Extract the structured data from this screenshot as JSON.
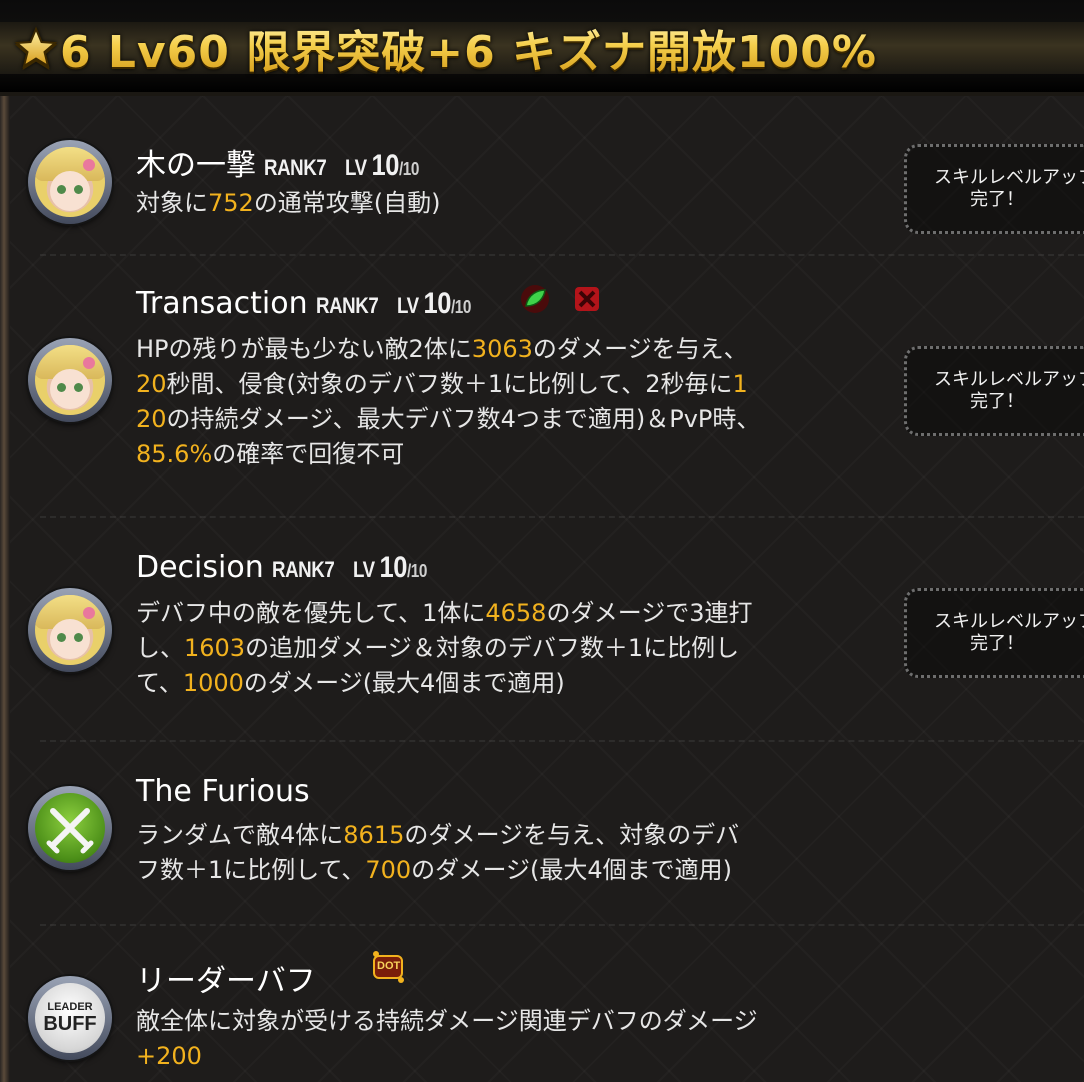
{
  "header": {
    "title": "6 Lv60 限界突破+6 キズナ開放100%"
  },
  "skills": [
    {
      "name": "木の一撃",
      "rank": "RANK7",
      "lv_prefix": "LV",
      "lv": "10",
      "lv_max": "/10",
      "desc": {
        "a": "対象に",
        "n1": "752",
        "b": "の通常攻撃(自動)"
      },
      "button": {
        "line1": "スキルレベルアップ",
        "line2": "完了！"
      }
    },
    {
      "name": "Transaction",
      "rank": "RANK7",
      "lv_prefix": "LV",
      "lv": "10",
      "lv_max": "/10",
      "desc": {
        "l1a": "HPの残りが最も少ない敵2体に",
        "n1": "3063",
        "l1b": "のダメージを与え、",
        "n2": "20",
        "l2a": "秒間、侵食(対象のデバフ数＋1に比例して、2秒毎に",
        "n3a": "1",
        "n3b": "20",
        "l3a": "の持続ダメージ、最大デバフ数4つまで適用)＆PvP時、",
        "n4": "85.6%",
        "l4a": "の確率で回復不可"
      },
      "button": {
        "line1": "スキルレベルアップ",
        "line2": "完了！"
      }
    },
    {
      "name": "Decision",
      "rank": "RANK7",
      "lv_prefix": "LV",
      "lv": "10",
      "lv_max": "/10",
      "desc": {
        "l1a": "デバフ中の敵を優先して、1体に",
        "n1": "4658",
        "l1b": "のダメージで3連打",
        "l2a": "し、",
        "n2": "1603",
        "l2b": "の追加ダメージ＆対象のデバフ数＋1に比例し",
        "l3a": "て、",
        "n3": "1000",
        "l3b": "のダメージ(最大4個まで適用)"
      },
      "button": {
        "line1": "スキルレベルアップ",
        "line2": "完了！"
      }
    },
    {
      "name": "The Furious",
      "desc": {
        "l1a": "ランダムで敵4体に",
        "n1": "8615",
        "l1b": "のダメージを与え、対象のデバ",
        "l2a": "フ数＋1に比例して、",
        "n2": "700",
        "l2b": "のダメージ(最大4個まで適用)"
      }
    },
    {
      "name": "リーダーバフ",
      "badge": {
        "leader": "LEADER",
        "buff": "BUFF",
        "dot": "DOT"
      },
      "desc": {
        "l1": "敵全体に対象が受ける持続ダメージ関連デバフのダメージ",
        "n1": "+200"
      }
    }
  ],
  "colors": {
    "accent": "#f2b21e",
    "title_gold": "#f5cf4c"
  },
  "icons": [
    "star-icon",
    "leaf-icon",
    "cross-icon",
    "swords-icon",
    "dot-icon"
  ]
}
